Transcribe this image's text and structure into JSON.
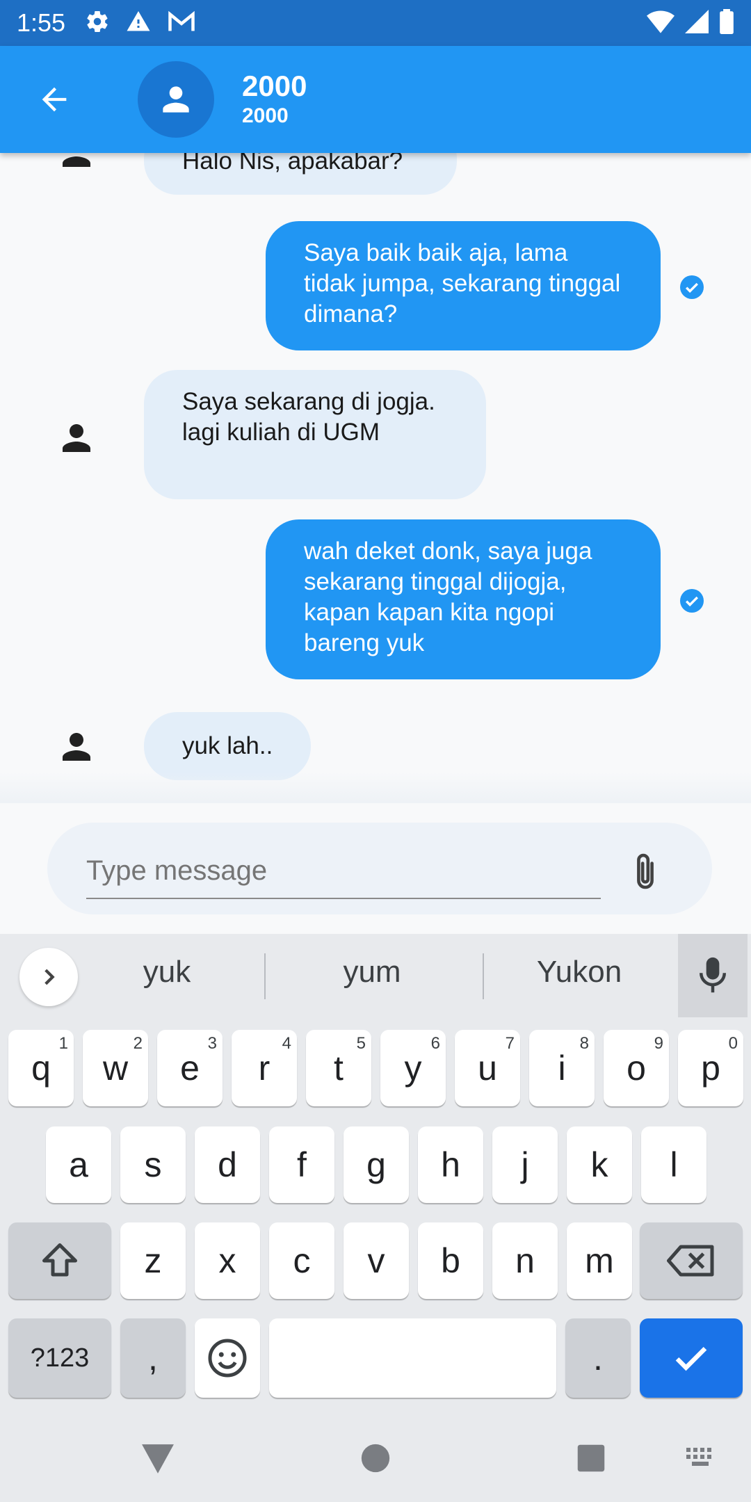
{
  "status_bar": {
    "time": "1:55",
    "icons_left": [
      "settings-icon",
      "warning-icon",
      "gmail-icon"
    ],
    "icons_right": [
      "wifi-icon",
      "signal-icon",
      "battery-icon"
    ]
  },
  "app_bar": {
    "title": "2000",
    "subtitle": "2000"
  },
  "messages": [
    {
      "direction": "in",
      "text": "Halo Nis, apakabar?"
    },
    {
      "direction": "out",
      "text": "Saya baik baik aja, lama tidak jumpa, sekarang tinggal dimana?",
      "status": "read"
    },
    {
      "direction": "in",
      "text": "Saya sekarang di jogja. lagi kuliah di UGM"
    },
    {
      "direction": "out",
      "text": "wah deket donk, saya juga sekarang tinggal dijogja, kapan kapan kita ngopi bareng yuk",
      "status": "read"
    },
    {
      "direction": "in",
      "text": "yuk lah.."
    }
  ],
  "composer": {
    "placeholder": "Type message",
    "value": ""
  },
  "keyboard": {
    "suggestions": [
      "yuk",
      "yum",
      "Yukon"
    ],
    "row1": [
      {
        "key": "q",
        "hint": "1"
      },
      {
        "key": "w",
        "hint": "2"
      },
      {
        "key": "e",
        "hint": "3"
      },
      {
        "key": "r",
        "hint": "4"
      },
      {
        "key": "t",
        "hint": "5"
      },
      {
        "key": "y",
        "hint": "6"
      },
      {
        "key": "u",
        "hint": "7"
      },
      {
        "key": "i",
        "hint": "8"
      },
      {
        "key": "o",
        "hint": "9"
      },
      {
        "key": "p",
        "hint": "0"
      }
    ],
    "row2": [
      "a",
      "s",
      "d",
      "f",
      "g",
      "h",
      "j",
      "k",
      "l"
    ],
    "row3": [
      "z",
      "x",
      "c",
      "v",
      "b",
      "n",
      "m"
    ],
    "symbols_label": "?123",
    "comma": ",",
    "period": "."
  },
  "colors": {
    "status_bar": "#1e6fc4",
    "app_bar": "#2196f3",
    "avatar": "#1976d2",
    "bubble_out": "#2196f3",
    "bubble_in": "#e3eef9",
    "enter_key": "#1a73e8"
  }
}
